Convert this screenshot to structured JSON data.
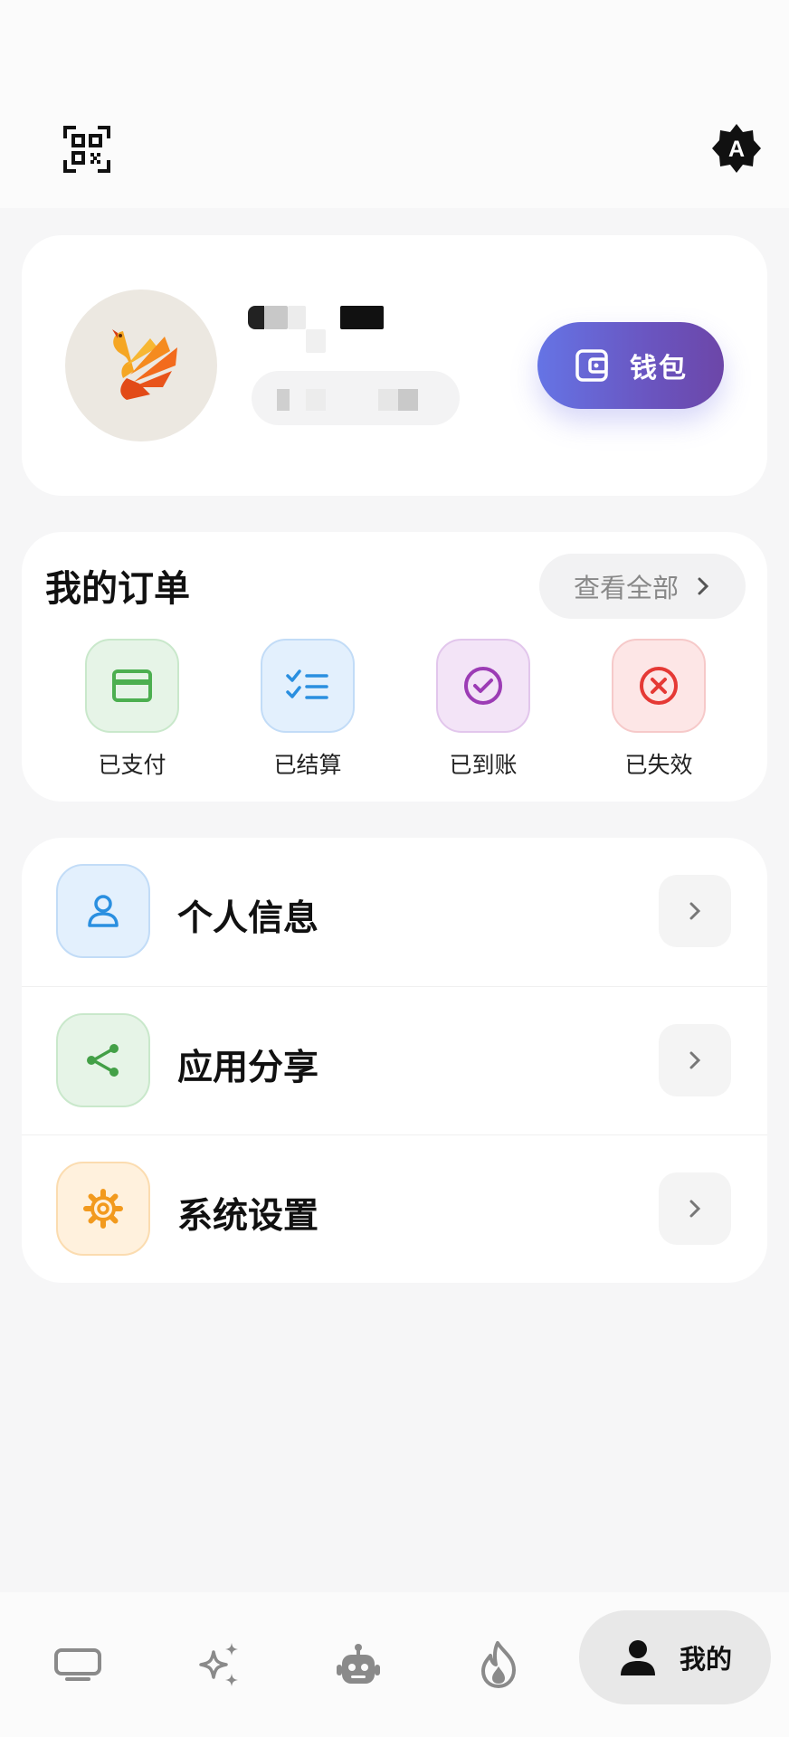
{
  "profile": {
    "wallet_label": "钱包"
  },
  "orders": {
    "title": "我的订单",
    "view_all": "查看全部",
    "items": [
      {
        "label": "已支付",
        "icon": "card-icon",
        "color": "#4caf50",
        "bg": "#e6f4e7",
        "border": "#c9e8cb"
      },
      {
        "label": "已结算",
        "icon": "checklist-icon",
        "color": "#2a8fe0",
        "bg": "#e3f0fd",
        "border": "#c2dcf7"
      },
      {
        "label": "已到账",
        "icon": "check-circle-icon",
        "color": "#9c3cb5",
        "bg": "#f3e4f7",
        "border": "#e2c6ec"
      },
      {
        "label": "已失效",
        "icon": "x-circle-icon",
        "color": "#e53935",
        "bg": "#fde6e6",
        "border": "#f6c9c9"
      }
    ]
  },
  "menu": {
    "items": [
      {
        "label": "个人信息",
        "icon": "user-icon",
        "color": "#2a8fe0",
        "bg": "#e3f0fd",
        "border": "#c2dcf7"
      },
      {
        "label": "应用分享",
        "icon": "share-icon",
        "color": "#43a047",
        "bg": "#e6f4e7",
        "border": "#c9e8cb"
      },
      {
        "label": "系统设置",
        "icon": "gear-icon",
        "color": "#f29a1e",
        "bg": "#fff1dd",
        "border": "#fbdcb0"
      }
    ]
  },
  "nav": {
    "items": [
      "tv-icon",
      "sparkles-icon",
      "robot-icon",
      "flame-icon"
    ],
    "active_label": "我的"
  }
}
